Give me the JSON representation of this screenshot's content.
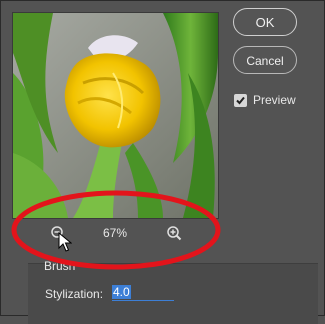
{
  "dialog": {
    "ok_label": "OK",
    "cancel_label": "Cancel",
    "preview_label": "Preview",
    "preview_checked": true
  },
  "zoom": {
    "level": "67%"
  },
  "brush": {
    "section_title": "Brush",
    "stylization_label": "Stylization:",
    "stylization_value": "4.0"
  },
  "colors": {
    "dialog_bg": "#535353",
    "annotation_red": "#e3141b",
    "selection_blue": "#3d7fd6"
  }
}
